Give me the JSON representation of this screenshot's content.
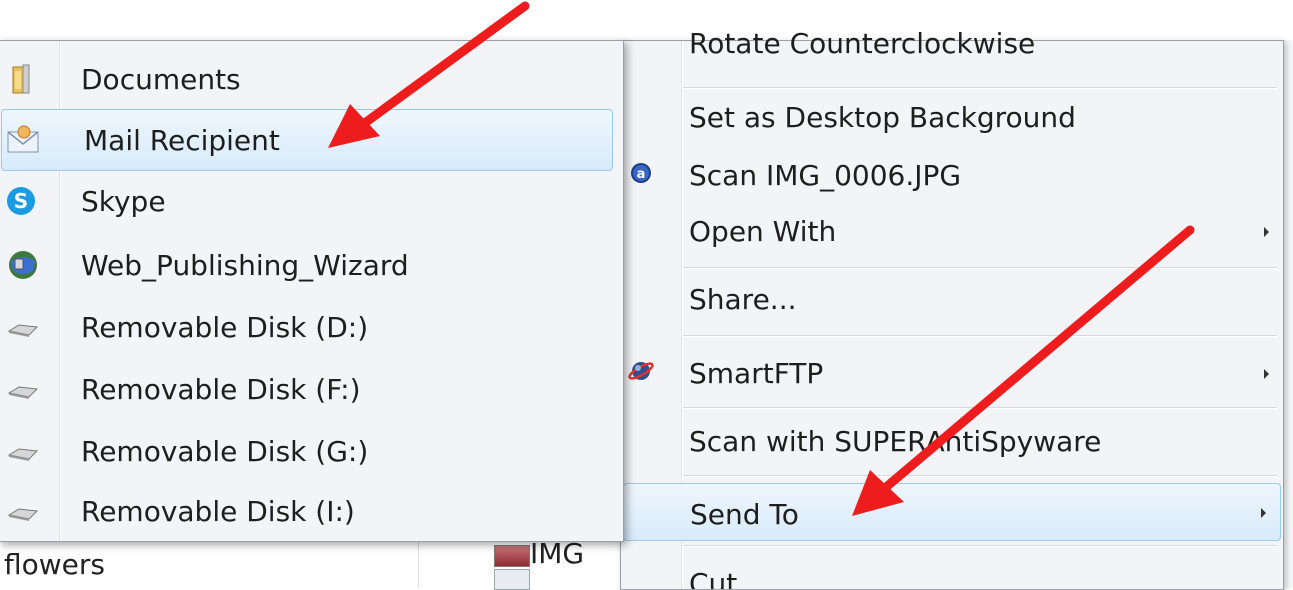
{
  "background": {
    "folder_label": "flowers",
    "file_label": "IMG"
  },
  "context_menu": {
    "items": [
      {
        "label": "Rotate Counterclockwise"
      },
      {
        "label": "Set as Desktop Background"
      },
      {
        "label": "Scan IMG_0006.JPG"
      },
      {
        "label": "Open With"
      },
      {
        "label": "Share..."
      },
      {
        "label": "SmartFTP"
      },
      {
        "label": "Scan with SUPERAntiSpyware"
      },
      {
        "label": "Send To"
      },
      {
        "label": "Cut"
      }
    ]
  },
  "send_to_menu": {
    "items": [
      {
        "label": "Documents",
        "icon": "documents-folder-icon"
      },
      {
        "label": "Mail Recipient",
        "icon": "mail-recipient-icon"
      },
      {
        "label": "Skype",
        "icon": "skype-icon"
      },
      {
        "label": "Web_Publishing_Wizard",
        "icon": "web-publishing-icon"
      },
      {
        "label": "Removable Disk (D:)",
        "icon": "removable-disk-icon"
      },
      {
        "label": "Removable Disk (F:)",
        "icon": "removable-disk-icon"
      },
      {
        "label": "Removable Disk (G:)",
        "icon": "removable-disk-icon"
      },
      {
        "label": "Removable Disk (I:)",
        "icon": "removable-disk-icon"
      }
    ]
  },
  "colors": {
    "highlight_border": "#9ec8ea",
    "highlight_fill": "#d8ebfa",
    "menu_bg": "#f3f4f7",
    "annotation_arrow": "#ee1c1c"
  }
}
